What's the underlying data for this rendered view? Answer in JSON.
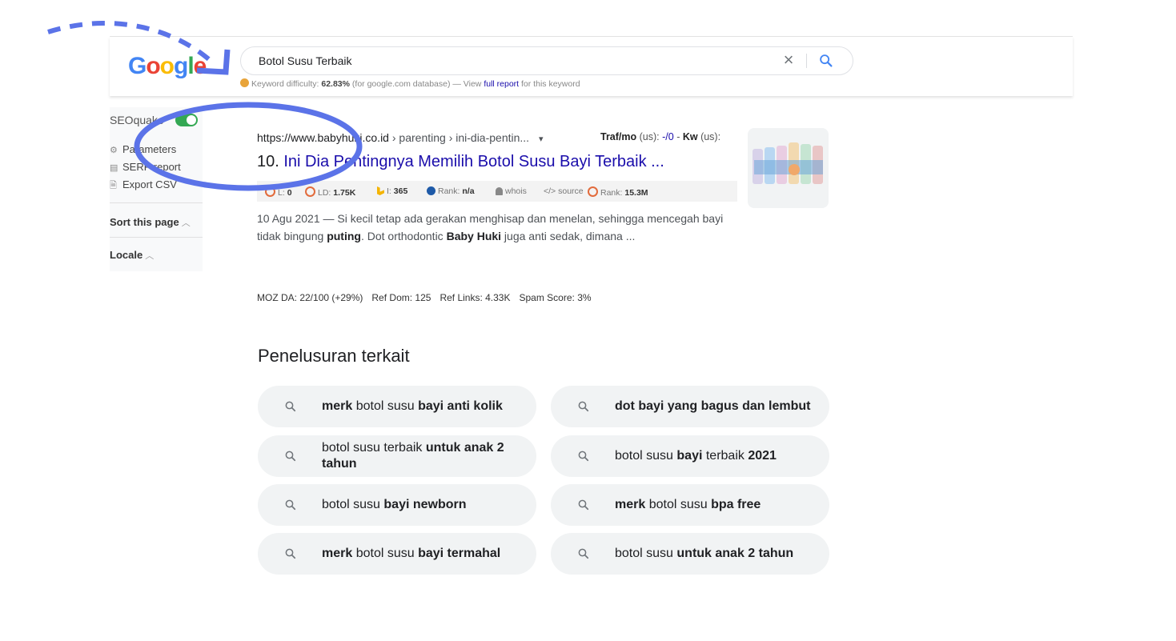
{
  "search": {
    "logo": "Google",
    "query": "Botol Susu Terbaik",
    "kd_label": "Keyword difficulty:",
    "kd_value": "62.83%",
    "kd_db": "(for google.com database) — View",
    "kd_link": "full report",
    "kd_tail": "for this keyword"
  },
  "sidebar": {
    "title": "SEOquake",
    "items": [
      {
        "label": "Parameters",
        "icon": "gear-icon"
      },
      {
        "label": "SERP report",
        "icon": "table-icon"
      },
      {
        "label": "Export CSV",
        "icon": "file-icon"
      }
    ],
    "sort_label": "Sort this page",
    "locale_label": "Locale"
  },
  "result": {
    "url_domain": "https://www.babyhuki.co.id",
    "url_path": " › parenting › ini-dia-pentin...",
    "dropdown": "▾",
    "traf_label": "Traf/mo",
    "traf_region": "(us):",
    "traf_value": "-/0",
    "kw_label": "Kw",
    "kw_region": "(us):",
    "number": "10.",
    "title": "Ini Dia Pentingnya Memilih Botol Susu Bayi Terbaik ...",
    "metrics": {
      "l_label": "L:",
      "l_value": "0",
      "ld_label": "LD:",
      "ld_value": "1.75K",
      "i_label": "I:",
      "i_value": "365",
      "rank_label": "Rank:",
      "rank_value": "n/a",
      "whois": "whois",
      "source": "source",
      "rank2_label": "Rank:",
      "rank2_value": "15.3M"
    },
    "snippet_date": "10 Agu 2021 — ",
    "snippet_1": "Si kecil tetap ada gerakan menghisap dan menelan, sehingga mencegah bayi tidak bingung ",
    "snippet_b1": "puting",
    "snippet_2": ". Dot orthodontic ",
    "snippet_b2": "Baby Huki",
    "snippet_3": " juga anti sedak, dimana ..."
  },
  "moz": {
    "da": "MOZ DA: 22/100 (+29%)",
    "ref_dom": "Ref Dom: 125",
    "ref_links": "Ref Links: 4.33K",
    "spam": "Spam Score: 3%"
  },
  "related": {
    "heading": "Penelusuran terkait",
    "chips": [
      [
        {
          "t": "merk",
          "b": true
        },
        {
          "t": " botol susu ",
          "b": false
        },
        {
          "t": "bayi anti kolik",
          "b": true
        }
      ],
      [
        {
          "t": "dot bayi yang bagus dan lembut",
          "b": true
        }
      ],
      [
        {
          "t": "botol susu terbaik ",
          "b": false
        },
        {
          "t": "untuk anak 2 tahun",
          "b": true
        }
      ],
      [
        {
          "t": "botol susu ",
          "b": false
        },
        {
          "t": "bayi",
          "b": true
        },
        {
          "t": " terbaik ",
          "b": false
        },
        {
          "t": "2021",
          "b": true
        }
      ],
      [
        {
          "t": "botol susu ",
          "b": false
        },
        {
          "t": "bayi newborn",
          "b": true
        }
      ],
      [
        {
          "t": "merk",
          "b": true
        },
        {
          "t": " botol susu ",
          "b": false
        },
        {
          "t": "bpa free",
          "b": true
        }
      ],
      [
        {
          "t": "merk",
          "b": true
        },
        {
          "t": " botol susu ",
          "b": false
        },
        {
          "t": "bayi termahal",
          "b": true
        }
      ],
      [
        {
          "t": "botol susu ",
          "b": false
        },
        {
          "t": "untuk anak 2 tahun",
          "b": true
        }
      ]
    ]
  },
  "colors": {
    "link": "#1a0dab",
    "annotation": "#5b73e8",
    "toggle": "#34a853"
  }
}
